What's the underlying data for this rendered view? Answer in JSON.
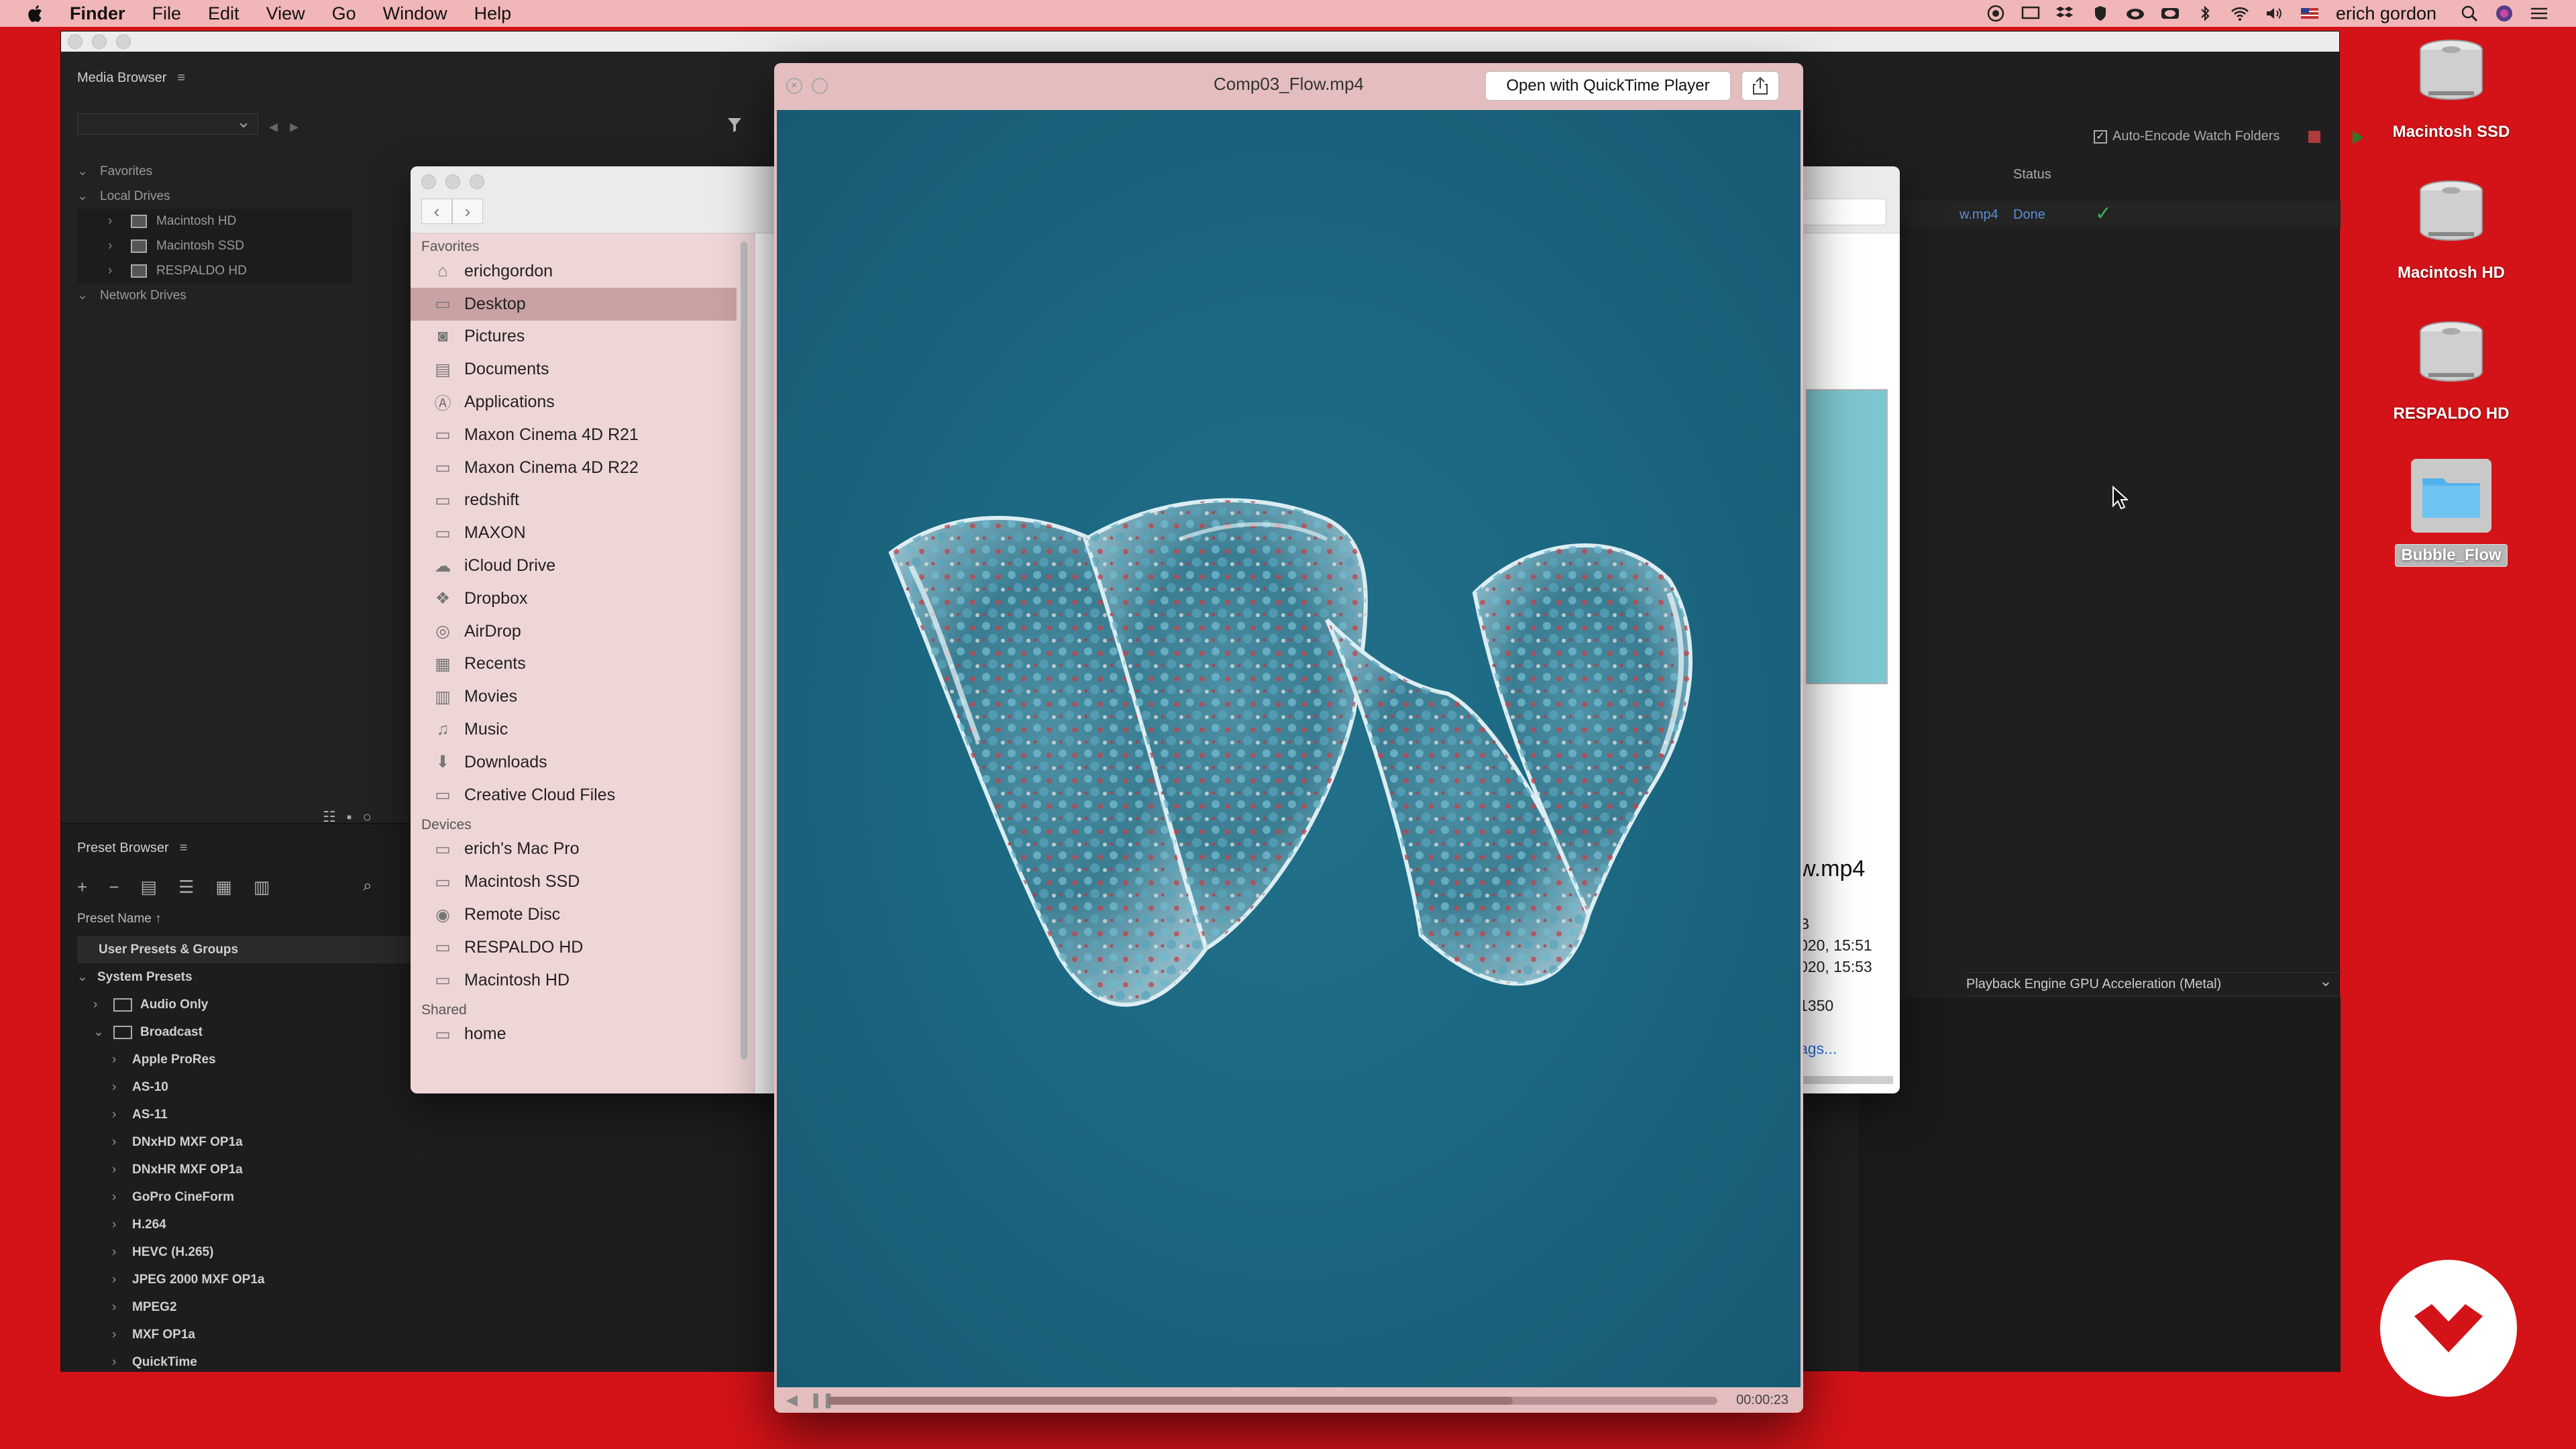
{
  "menubar": {
    "app_name": "Finder",
    "items": [
      "File",
      "Edit",
      "View",
      "Go",
      "Window",
      "Help"
    ],
    "user": "erich gordon"
  },
  "media_browser": {
    "title": "Media Browser",
    "favorites": "Favorites",
    "local_drives": "Local Drives",
    "drives": [
      "Macintosh HD",
      "Macintosh SSD",
      "RESPALDO HD"
    ],
    "network_drives": "Network Drives"
  },
  "preset_browser": {
    "title": "Preset Browser",
    "column_header": "Preset Name",
    "user_presets": "User Presets & Groups",
    "system_presets": "System Presets",
    "audio_only": "Audio Only",
    "broadcast": "Broadcast",
    "presets": [
      "Apple ProRes",
      "AS-10",
      "AS-11",
      "DNxHD MXF OP1a",
      "DNxHR MXF OP1a",
      "GoPro CineForm",
      "H.264",
      "HEVC (H.265)",
      "JPEG 2000 MXF OP1a",
      "MPEG2",
      "MXF OP1a",
      "QuickTime"
    ]
  },
  "queue": {
    "auto_encode": "Auto-Encode Watch Folders",
    "status_header": "Status",
    "file_fragment": "w.mp4",
    "status_done": "Done",
    "renderer": "Playback Engine GPU Acceleration (Metal)"
  },
  "finder": {
    "favorites_label": "Favorites",
    "favorites": [
      "erichgordon",
      "Desktop",
      "Pictures",
      "Documents",
      "Applications",
      "Maxon Cinema 4D R21",
      "Maxon Cinema 4D R22",
      "redshift",
      "MAXON",
      "iCloud Drive",
      "Dropbox",
      "AirDrop",
      "Recents",
      "Movies",
      "Music",
      "Downloads",
      "Creative Cloud Files"
    ],
    "devices_label": "Devices",
    "devices": [
      "erich's Mac Pro",
      "Macintosh SSD",
      "Remote Disc",
      "RESPALDO HD",
      "Macintosh HD"
    ],
    "shared_label": "Shared",
    "shared": [
      "home"
    ],
    "info": {
      "name": "w.mp4",
      "size_fragment": "B",
      "created": "020, 15:51",
      "modified": "020, 15:53",
      "dimensions": "1350",
      "more_link": "ags..."
    }
  },
  "quicklook": {
    "filename": "Comp03_Flow.mp4",
    "open_button": "Open with QuickTime Player",
    "time": "00:00:23",
    "progress_fraction": 0.77
  },
  "desktop": {
    "icons": [
      "Macintosh SSD",
      "Macintosh HD",
      "RESPALDO HD",
      "Bubble_Flow"
    ]
  },
  "colors": {
    "desktop_red": "#d41318",
    "menubar_pink": "#f1b6b7",
    "video_teal": "#1c6882",
    "finder_sidebar": "#efd6d6",
    "done_green": "#34b04a"
  }
}
